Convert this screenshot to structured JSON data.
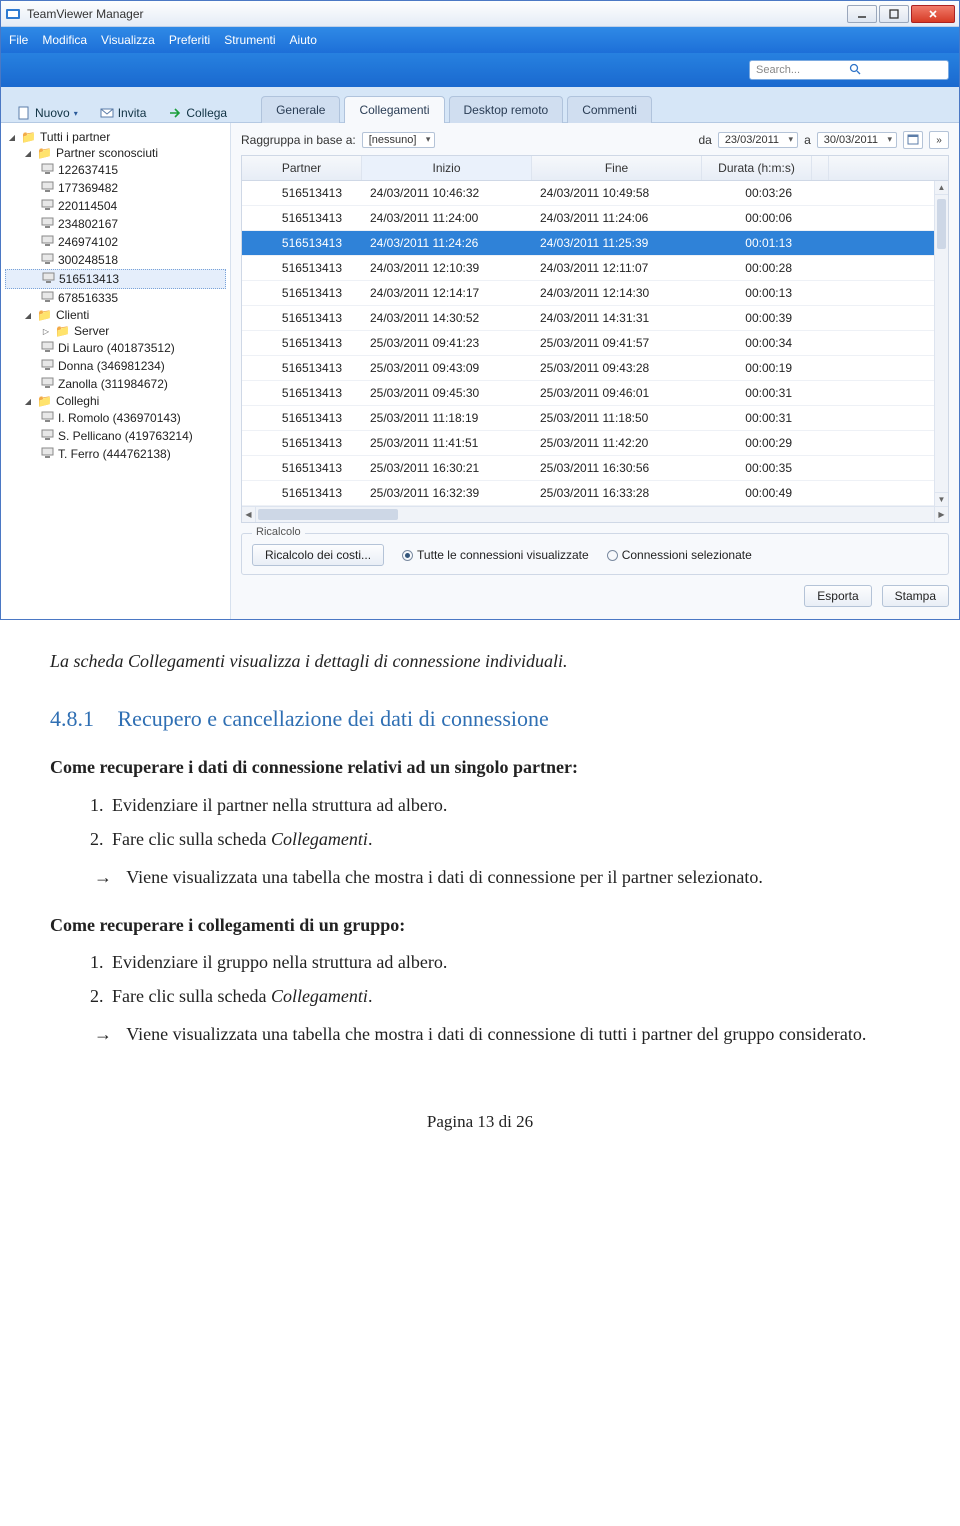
{
  "window": {
    "title": "TeamViewer Manager"
  },
  "menubar": {
    "items": [
      "File",
      "Modifica",
      "Visualizza",
      "Preferiti",
      "Strumenti",
      "Aiuto"
    ]
  },
  "search": {
    "placeholder": "Search..."
  },
  "ribbon": {
    "nuovo": "Nuovo",
    "invita": "Invita",
    "collega": "Collega"
  },
  "tabs": {
    "generale": "Generale",
    "collegamenti": "Collegamenti",
    "desktop_remoto": "Desktop remoto",
    "commenti": "Commenti"
  },
  "sidebar": {
    "all_partners": "Tutti i partner",
    "unknown_partners": "Partner sconosciuti",
    "unknown_items": [
      "122637415",
      "177369482",
      "220114504",
      "234802167",
      "246974102",
      "300248518",
      "516513413",
      "678516335"
    ],
    "clienti": "Clienti",
    "clienti_items": [
      "Server",
      "Di Lauro (401873512)",
      "Donna (346981234)",
      "Zanolla (311984672)"
    ],
    "colleghi": "Colleghi",
    "colleghi_items": [
      "I. Romolo (436970143)",
      "S. Pellicano (419763214)",
      "T. Ferro (444762138)"
    ]
  },
  "filters": {
    "group_label": "Raggruppa in base a:",
    "group_value": "[nessuno]",
    "from_label": "da",
    "from_value": "23/03/2011",
    "to_label": "a",
    "to_value": "30/03/2011"
  },
  "grid": {
    "headers": {
      "partner": "Partner",
      "inizio": "Inizio",
      "fine": "Fine",
      "durata": "Durata (h:m:s)"
    },
    "rows": [
      {
        "partner": "516513413",
        "inizio": "24/03/2011 10:46:32",
        "fine": "24/03/2011 10:49:58",
        "durata": "00:03:26",
        "sel": false
      },
      {
        "partner": "516513413",
        "inizio": "24/03/2011 11:24:00",
        "fine": "24/03/2011 11:24:06",
        "durata": "00:00:06",
        "sel": false
      },
      {
        "partner": "516513413",
        "inizio": "24/03/2011 11:24:26",
        "fine": "24/03/2011 11:25:39",
        "durata": "00:01:13",
        "sel": true
      },
      {
        "partner": "516513413",
        "inizio": "24/03/2011 12:10:39",
        "fine": "24/03/2011 12:11:07",
        "durata": "00:00:28",
        "sel": false
      },
      {
        "partner": "516513413",
        "inizio": "24/03/2011 12:14:17",
        "fine": "24/03/2011 12:14:30",
        "durata": "00:00:13",
        "sel": false
      },
      {
        "partner": "516513413",
        "inizio": "24/03/2011 14:30:52",
        "fine": "24/03/2011 14:31:31",
        "durata": "00:00:39",
        "sel": false
      },
      {
        "partner": "516513413",
        "inizio": "25/03/2011 09:41:23",
        "fine": "25/03/2011 09:41:57",
        "durata": "00:00:34",
        "sel": false
      },
      {
        "partner": "516513413",
        "inizio": "25/03/2011 09:43:09",
        "fine": "25/03/2011 09:43:28",
        "durata": "00:00:19",
        "sel": false
      },
      {
        "partner": "516513413",
        "inizio": "25/03/2011 09:45:30",
        "fine": "25/03/2011 09:46:01",
        "durata": "00:00:31",
        "sel": false
      },
      {
        "partner": "516513413",
        "inizio": "25/03/2011 11:18:19",
        "fine": "25/03/2011 11:18:50",
        "durata": "00:00:31",
        "sel": false
      },
      {
        "partner": "516513413",
        "inizio": "25/03/2011 11:41:51",
        "fine": "25/03/2011 11:42:20",
        "durata": "00:00:29",
        "sel": false
      },
      {
        "partner": "516513413",
        "inizio": "25/03/2011 16:30:21",
        "fine": "25/03/2011 16:30:56",
        "durata": "00:00:35",
        "sel": false
      },
      {
        "partner": "516513413",
        "inizio": "25/03/2011 16:32:39",
        "fine": "25/03/2011 16:33:28",
        "durata": "00:00:49",
        "sel": false
      }
    ]
  },
  "recalc": {
    "legend": "Ricalcolo",
    "button": "Ricalcolo dei costi...",
    "radio_all": "Tutte le connessioni visualizzate",
    "radio_sel": "Connessioni selezionate"
  },
  "bottom": {
    "esporta": "Esporta",
    "stampa": "Stampa"
  },
  "doc": {
    "caption": "La scheda Collegamenti visualizza i dettagli di connessione individuali.",
    "sec_no": "4.8.1",
    "sec_title": "Recupero e cancellazione dei dati di connessione",
    "h_partner": "Come recuperare i dati di connessione relativi ad un singolo partner:",
    "li_p1": "Evidenziare il partner nella struttura ad albero.",
    "li_p2_prefix": "Fare clic sulla scheda ",
    "li_p2_em": "Collegamenti",
    "arrow_partner": "Viene visualizzata una tabella che mostra i dati di connessione per il partner selezionato.",
    "h_group": "Come recuperare i collegamenti di un gruppo:",
    "li_g1": "Evidenziare il gruppo nella struttura ad albero.",
    "li_g2_prefix": "Fare clic sulla scheda ",
    "li_g2_em": "Collegamenti",
    "arrow_group": "Viene visualizzata una tabella che mostra i dati di connessione di tutti i partner del gruppo considerato.",
    "footer": "Pagina 13 di 26"
  }
}
